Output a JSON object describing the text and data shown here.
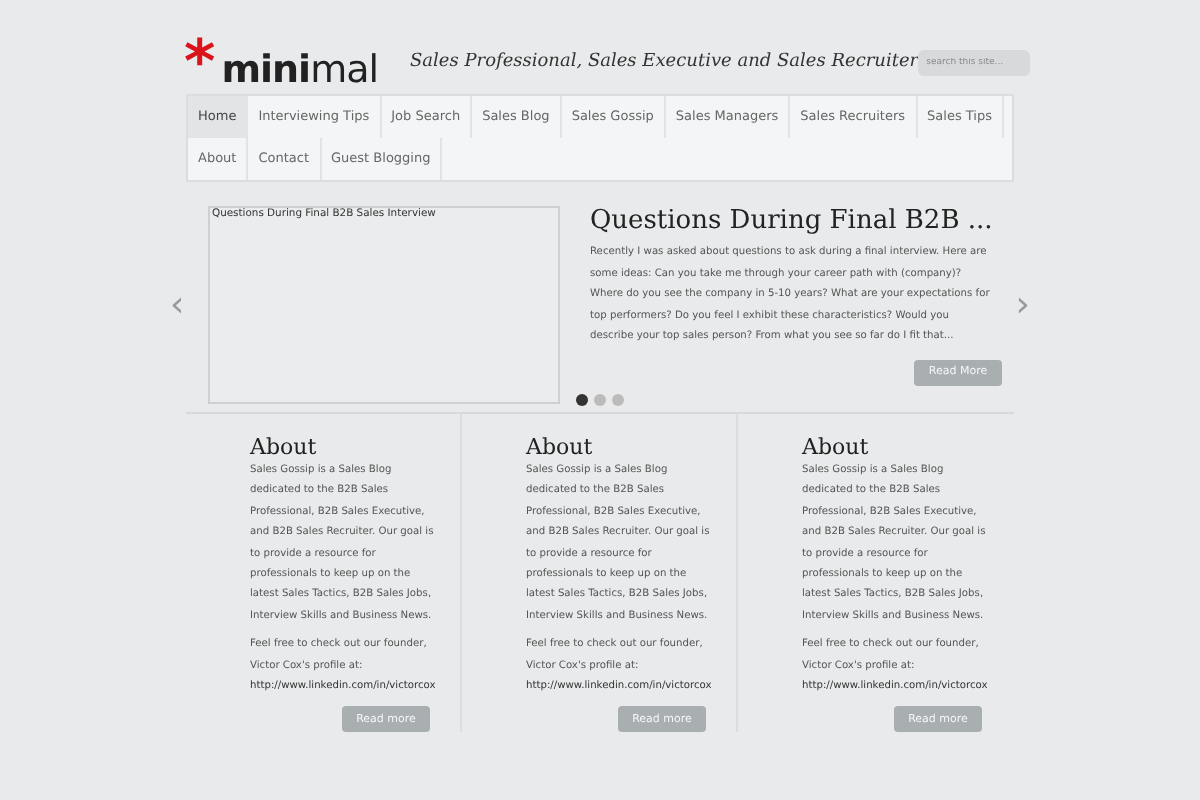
{
  "logo": {
    "mark": "*",
    "bold": "mini",
    "light": "mal"
  },
  "tagline": "Sales Professional, Sales Executive and Sales Recruiter",
  "search": {
    "placeholder": "search this site..."
  },
  "nav": [
    {
      "label": "Home",
      "selected": true
    },
    {
      "label": "Interviewing Tips",
      "selected": false
    },
    {
      "label": "Job Search",
      "selected": false
    },
    {
      "label": "Sales Blog",
      "selected": false
    },
    {
      "label": "Sales Gossip",
      "selected": false
    },
    {
      "label": "Sales Managers",
      "selected": false
    },
    {
      "label": "Sales Recruiters",
      "selected": false
    },
    {
      "label": "Sales Tips",
      "selected": false
    },
    {
      "label": "About",
      "selected": false
    },
    {
      "label": "Contact",
      "selected": false
    },
    {
      "label": "Guest Blogging",
      "selected": false
    }
  ],
  "slider": {
    "prev": "‹",
    "next": "›",
    "image_caption": "Questions During Final B2B Sales Interview",
    "title": "Questions During Final B2B ...",
    "excerpt": "Recently I was asked about questions to ask during a final interview. Here are some ideas:   Can you take me through your career path with (company)? Where do you see the company in 5-10 years? What are your expectations for top performers? Do you feel I exhibit these characteristics? Would you describe your top sales person? From what you see so far do I fit that...",
    "button": "Read More",
    "dots": [
      {
        "selected": true
      },
      {
        "selected": false
      },
      {
        "selected": false
      }
    ]
  },
  "columns": [
    {
      "title": "About",
      "body": "Sales Gossip is a Sales Blog dedicated to the B2B Sales Professional, B2B Sales Executive, and B2B Sales Recruiter. Our goal is to provide a resource for professionals to keep up on the latest Sales Tactics, B2B Sales Jobs, Interview Skills and Business News.",
      "founder": "Feel free to check out our founder, Victor Cox's profile at:",
      "link": "http://www.linkedin.com/in/victorcox",
      "button": "Read more"
    },
    {
      "title": "About",
      "body": "Sales Gossip is a Sales Blog dedicated to the B2B Sales Professional, B2B Sales Executive, and B2B Sales Recruiter. Our goal is to provide a resource for professionals to keep up on the latest Sales Tactics, B2B Sales Jobs, Interview Skills and Business News.",
      "founder": "Feel free to check out our founder, Victor Cox's profile at:",
      "link": "http://www.linkedin.com/in/victorcox",
      "button": "Read more"
    },
    {
      "title": "About",
      "body": "Sales Gossip is a Sales Blog dedicated to the B2B Sales Professional, B2B Sales Executive, and B2B Sales Recruiter. Our goal is to provide a resource for professionals to keep up on the latest Sales Tactics, B2B Sales Jobs, Interview Skills and Business News.",
      "founder": "Feel free to check out our founder, Victor Cox's profile at:",
      "link": "http://www.linkedin.com/in/victorcox",
      "button": "Read more"
    }
  ]
}
